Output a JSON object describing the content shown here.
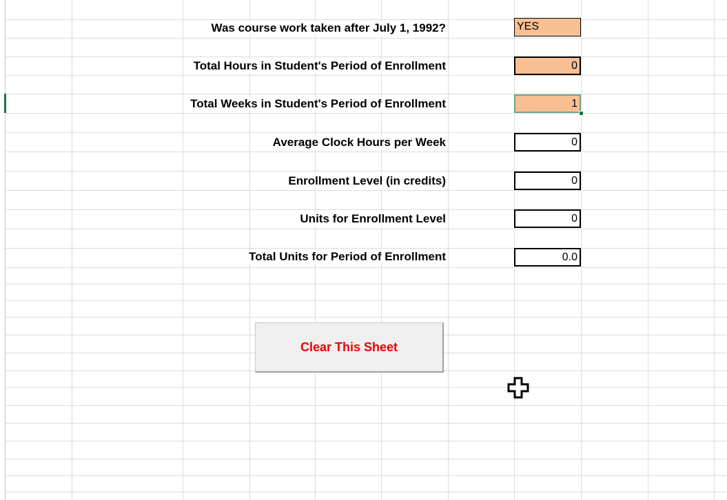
{
  "form": {
    "rows": [
      {
        "label": "Was course work taken after July 1, 1992?",
        "value": "YES"
      },
      {
        "label": "Total Hours in Student's Period of Enrollment",
        "value": "0"
      },
      {
        "label": "Total Weeks in Student's Period of Enrollment",
        "value": "1"
      },
      {
        "label": "Average Clock Hours per Week",
        "value": "0"
      },
      {
        "label": "Enrollment Level (in credits)",
        "value": "0"
      },
      {
        "label": "Units for Enrollment Level",
        "value": "0"
      },
      {
        "label": "Total Units for Period of Enrollment",
        "value": "0.0"
      }
    ]
  },
  "button": {
    "clear_label": "Clear This Sheet"
  },
  "colors": {
    "input_fill": "#f8bf93",
    "button_text": "#ee0000",
    "selection_green": "#217346"
  },
  "cursor": {
    "icon": "plus-cursor-icon"
  }
}
